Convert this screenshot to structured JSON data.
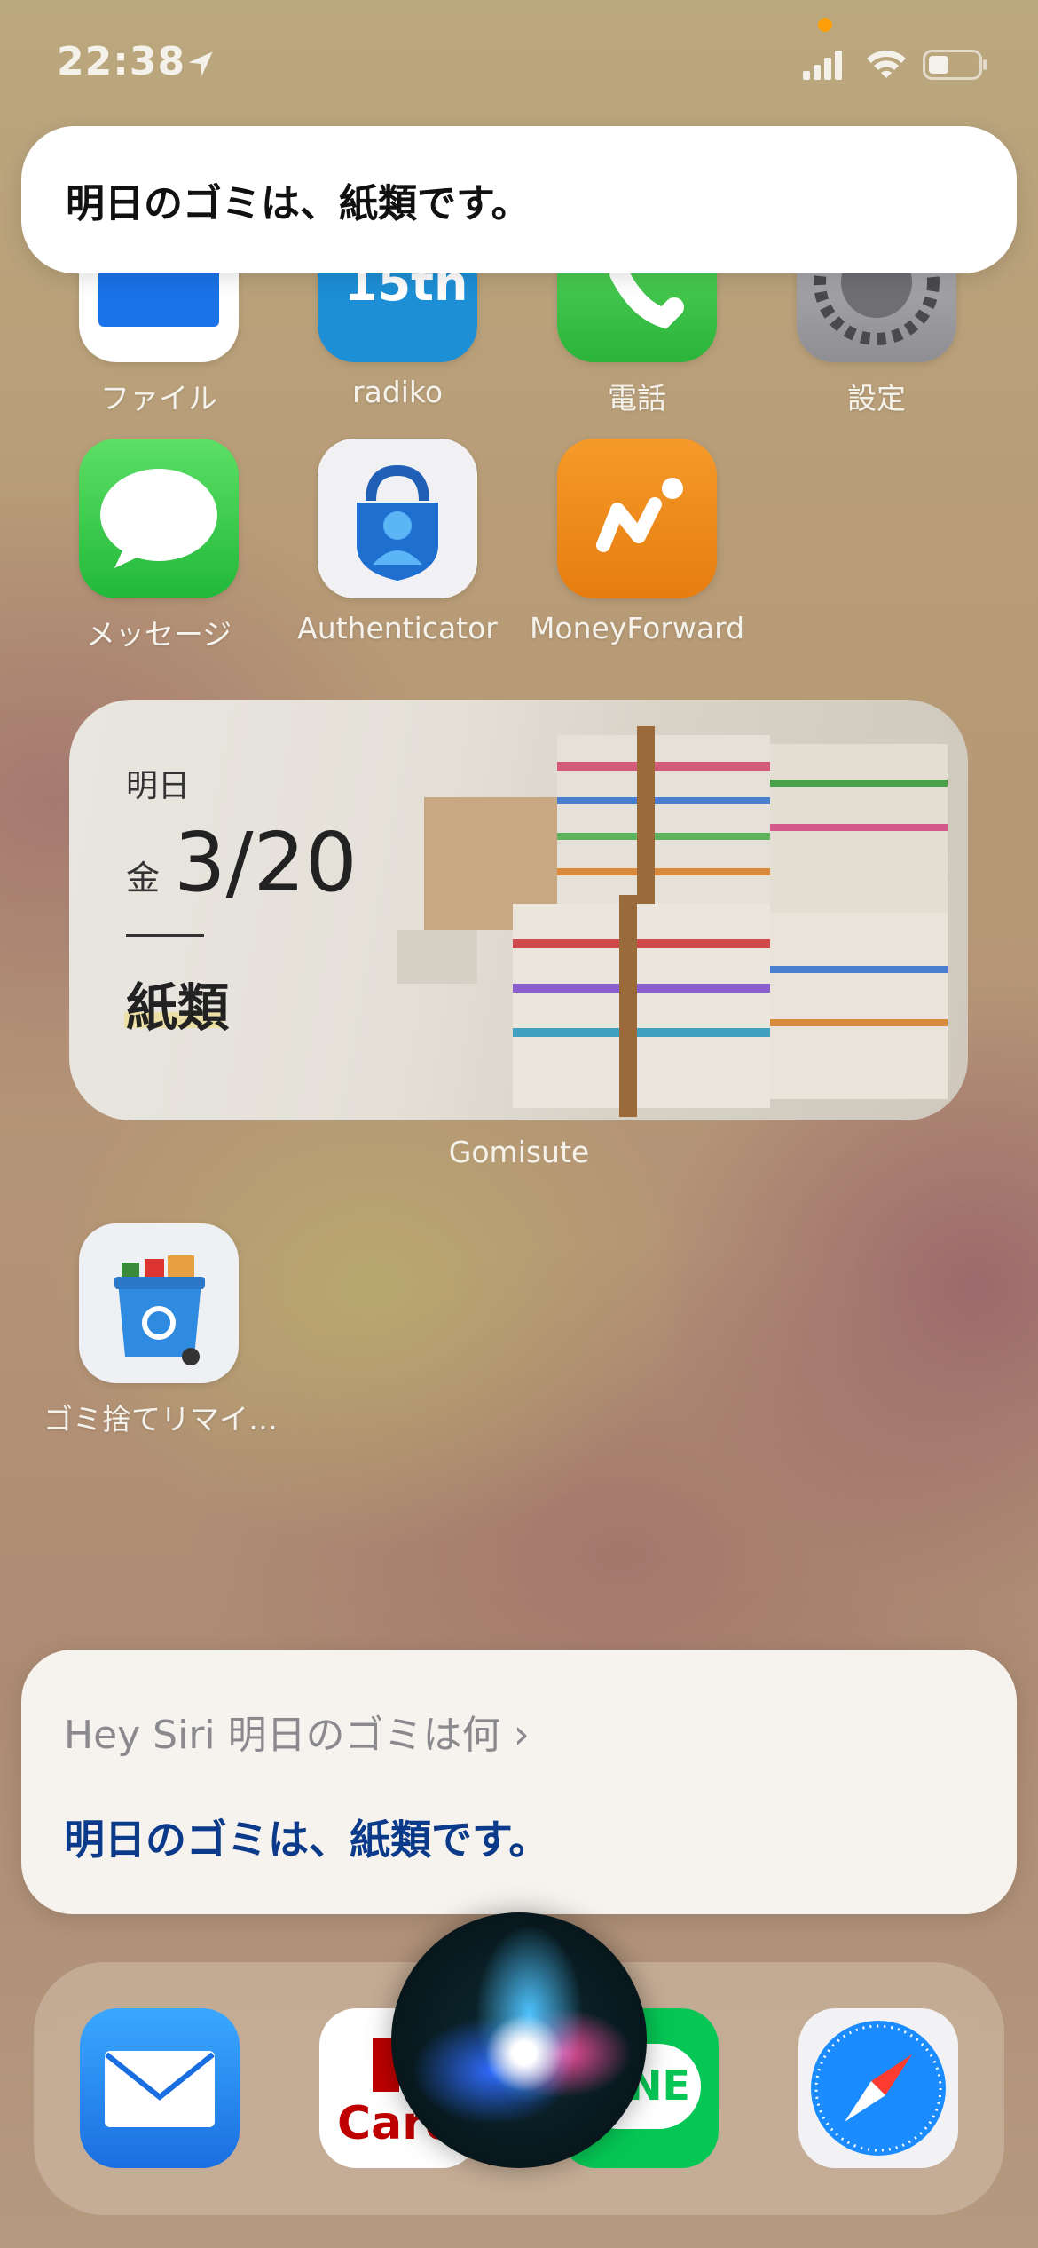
{
  "status": {
    "time": "22:38"
  },
  "banner": {
    "text": "明日のゴミは、紙類です。"
  },
  "apps_row1": [
    {
      "label": "ファイル",
      "icon": "files-icon"
    },
    {
      "label": "radiko",
      "icon": "radiko-icon"
    },
    {
      "label": "電話",
      "icon": "phone-icon"
    },
    {
      "label": "設定",
      "icon": "settings-icon"
    }
  ],
  "apps_row2": [
    {
      "label": "メッセージ",
      "icon": "messages-icon"
    },
    {
      "label": "Authenticator",
      "icon": "authenticator-icon"
    },
    {
      "label": "MoneyForward",
      "icon": "moneyforward-icon"
    }
  ],
  "widget": {
    "label_tomorrow": "明日",
    "weekday": "金",
    "date": "3/20",
    "kind": "紙類",
    "caption": "Gomisute"
  },
  "apps_row3": [
    {
      "label": "ゴミ捨てリマイ…",
      "icon": "trash-reminder-icon"
    }
  ],
  "siri": {
    "query": "Hey Siri 明日のゴミは何",
    "answer": "明日のゴミは、紙類です。"
  },
  "dock": {
    "apps": [
      "mail-icon",
      "rakuten-card-icon",
      "line-icon",
      "safari-icon"
    ],
    "rakuten_text": "Card",
    "line_text": "NE"
  },
  "colors": {
    "accent_blue": "#0b3a8a",
    "messages_green": "#34c759",
    "moneyforward_orange": "#f08a1c"
  }
}
